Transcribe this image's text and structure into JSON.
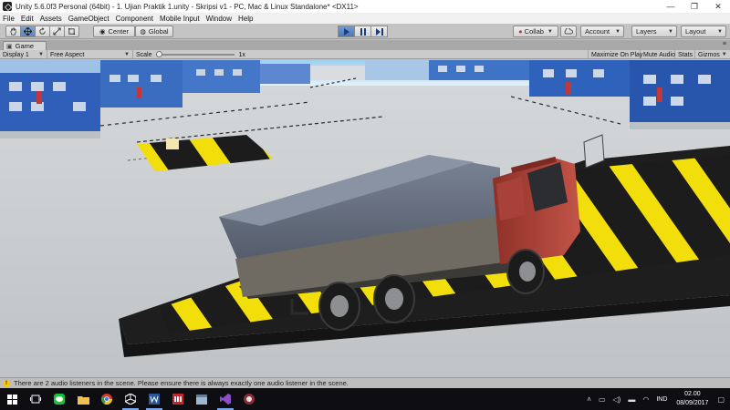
{
  "window": {
    "title": "Unity 5.6.0f3 Personal (64bit) - 1. Ujian Praktik 1.unity - Skripsi v1 - PC, Mac & Linux Standalone* <DX11>",
    "minimize": "—",
    "maximize": "❐",
    "close": "✕"
  },
  "menu": [
    "File",
    "Edit",
    "Assets",
    "GameObject",
    "Component",
    "Mobile Input",
    "Window",
    "Help"
  ],
  "toolbar": {
    "pivot_label": "Center",
    "space_label": "Global",
    "collab_label": "Collab",
    "account_label": "Account",
    "layers_label": "Layers",
    "layout_label": "Layout"
  },
  "game_tab": {
    "label": "Game",
    "display_label": "Display 1",
    "aspect_label": "Free Aspect",
    "scale_label": "Scale",
    "scale_value": "1x",
    "scale_level": 0,
    "maximize_label": "Maximize On Play",
    "mute_label": "Mute Audio",
    "stats_label": "Stats",
    "gizmos_label": "Gizmos"
  },
  "console": {
    "message": "There are 2 audio listeners in the scene. Please ensure there is always exactly one audio listener in the scene."
  },
  "taskbar": {
    "language": "IND",
    "time": "02.00",
    "date": "08/09/2017"
  },
  "colors": {
    "play_active": "#5a86c0",
    "hazard_yellow": "#f2de0a",
    "truck_cab_red": "#b2453a",
    "tarp_blue": "#6b7486"
  }
}
